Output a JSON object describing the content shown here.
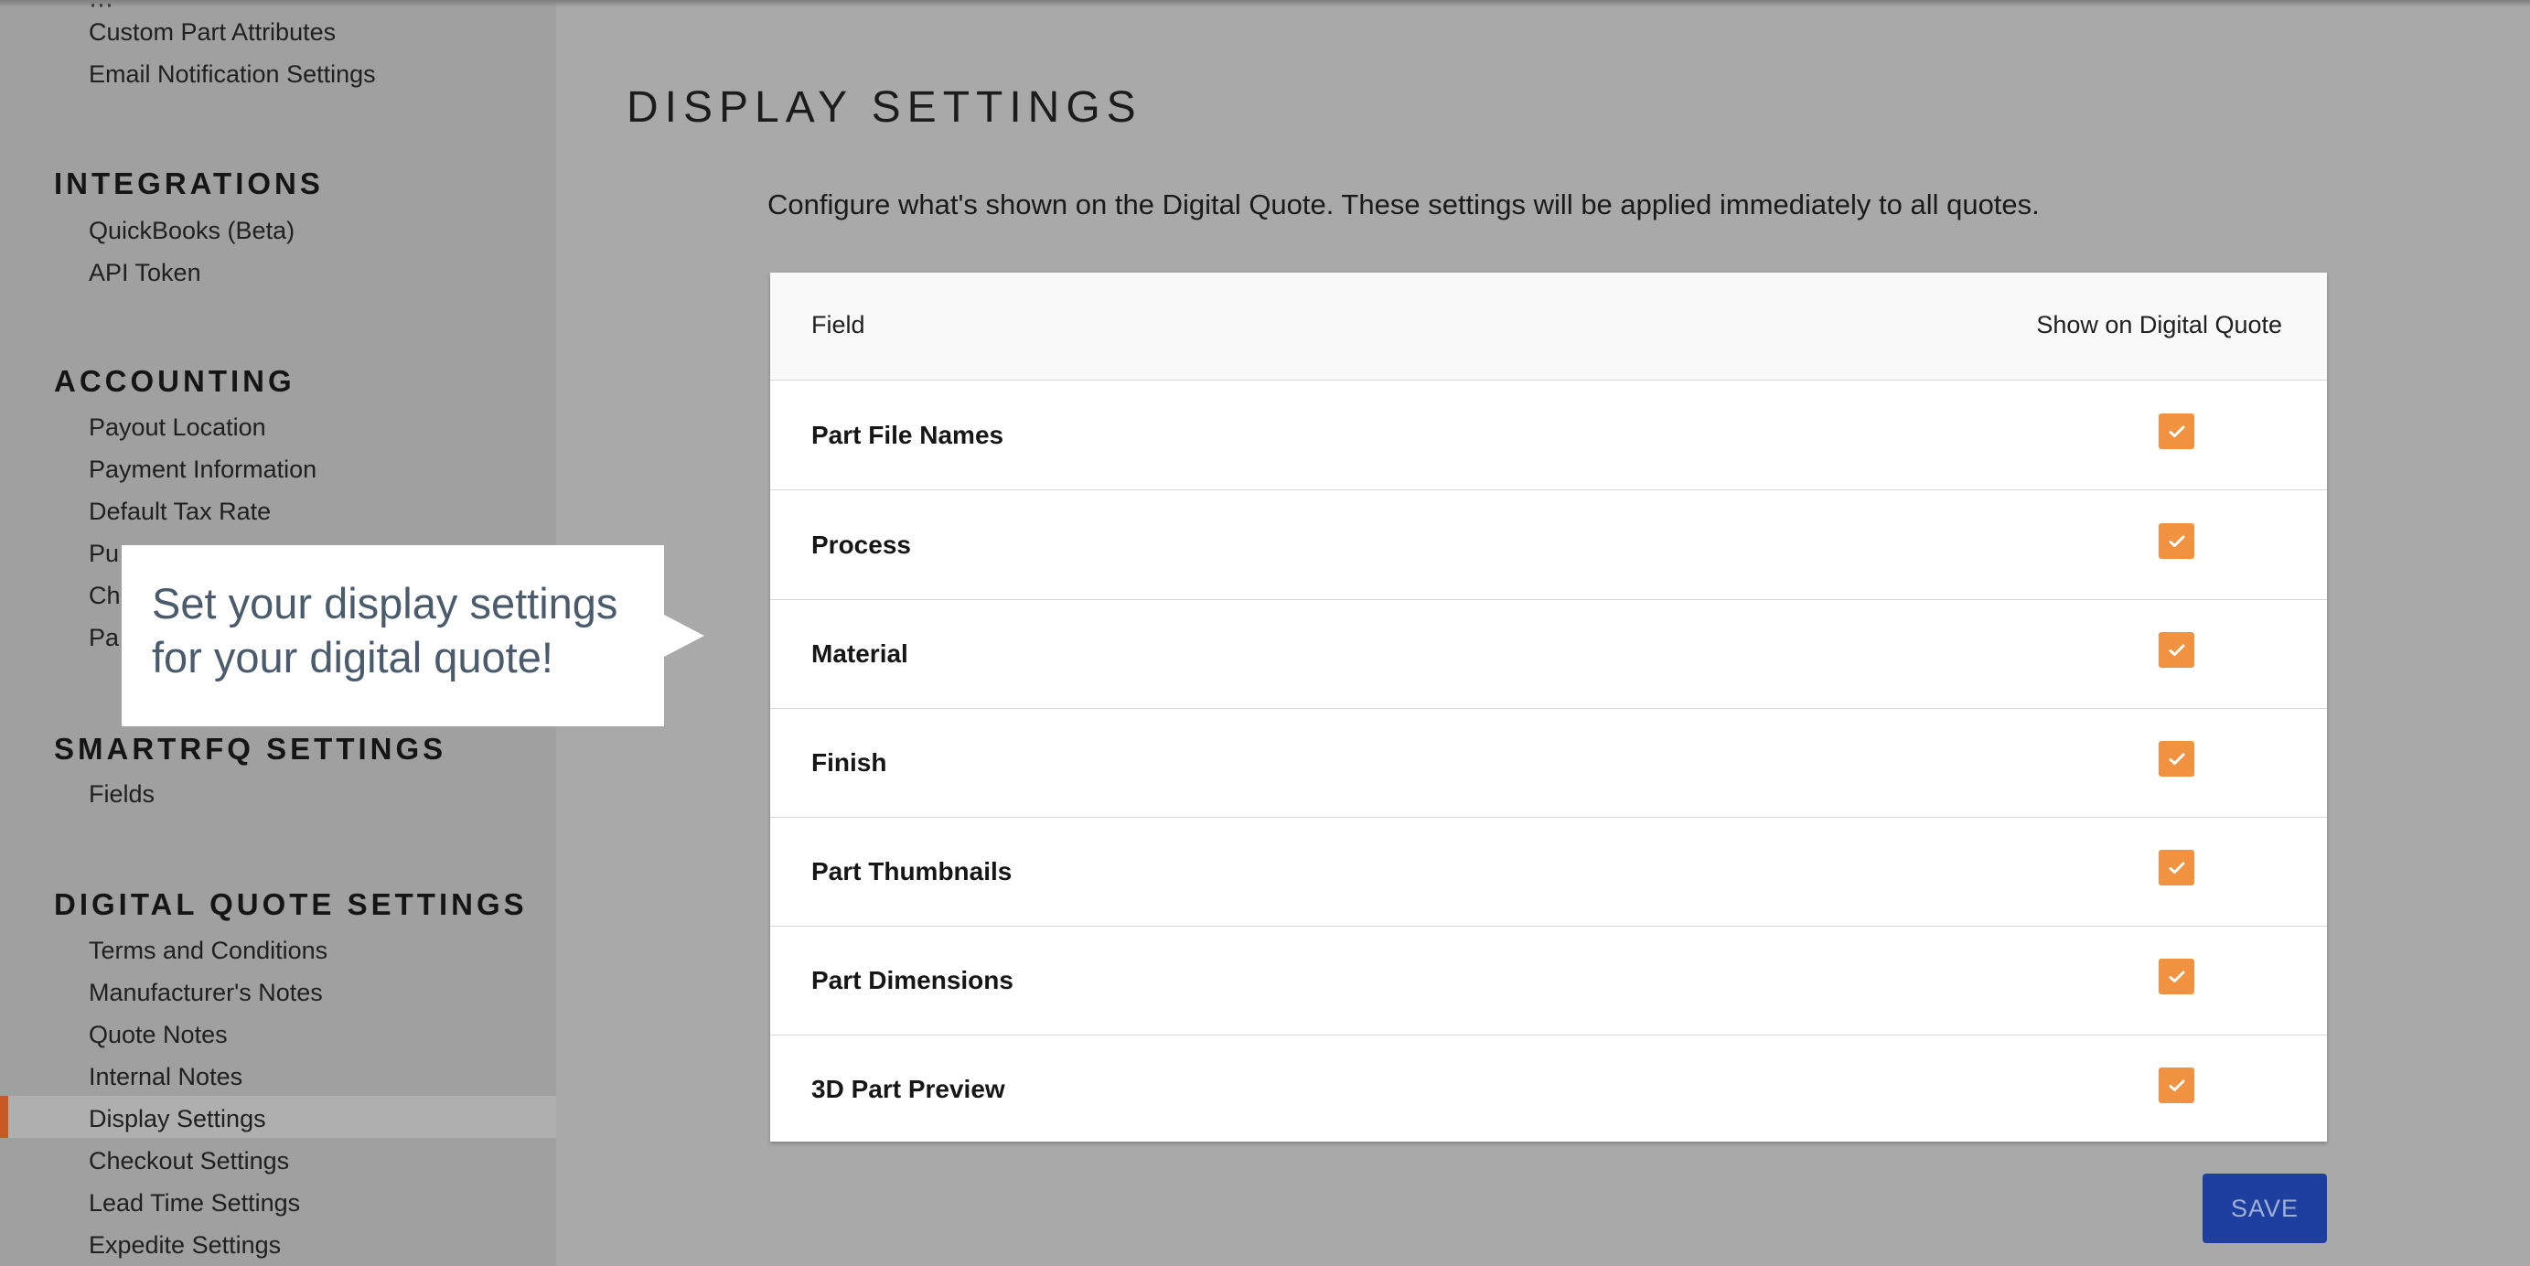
{
  "sidebar": {
    "top_items": [
      "Custom Part Attributes",
      "Email Notification Settings"
    ],
    "groups": [
      {
        "title": "INTEGRATIONS",
        "items": [
          "QuickBooks (Beta)",
          "API Token"
        ]
      },
      {
        "title": "ACCOUNTING",
        "items": [
          "Payout Location",
          "Payment Information",
          "Default Tax Rate",
          "Pu",
          "Ch",
          "Pa"
        ]
      },
      {
        "title": "SMARTRFQ SETTINGS",
        "items": [
          "Fields"
        ]
      },
      {
        "title": "DIGITAL QUOTE SETTINGS",
        "items": [
          "Terms and Conditions",
          "Manufacturer's Notes",
          "Quote Notes",
          "Internal Notes",
          "Display Settings",
          "Checkout Settings",
          "Lead Time Settings",
          "Expedite Settings"
        ]
      }
    ],
    "active_item": "Display Settings"
  },
  "main": {
    "title": "DISPLAY SETTINGS",
    "description": "Configure what's shown on the Digital Quote. These settings will be applied immediately to all quotes.",
    "table": {
      "col_field": "Field",
      "col_show": "Show on Digital Quote",
      "rows": [
        {
          "label": "Part File Names",
          "checked": true
        },
        {
          "label": "Process",
          "checked": true
        },
        {
          "label": "Material",
          "checked": true
        },
        {
          "label": "Finish",
          "checked": true
        },
        {
          "label": "Part Thumbnails",
          "checked": true
        },
        {
          "label": "Part Dimensions",
          "checked": true
        },
        {
          "label": "3D Part Preview",
          "checked": true
        }
      ]
    },
    "save_label": "SAVE"
  },
  "tooltip": {
    "line1": "Set your display settings",
    "line2": "for your digital quote!"
  },
  "colors": {
    "accent_checkbox": "#f0923f",
    "save_button": "#1e3fa0",
    "active_indicator": "#c75a24"
  }
}
